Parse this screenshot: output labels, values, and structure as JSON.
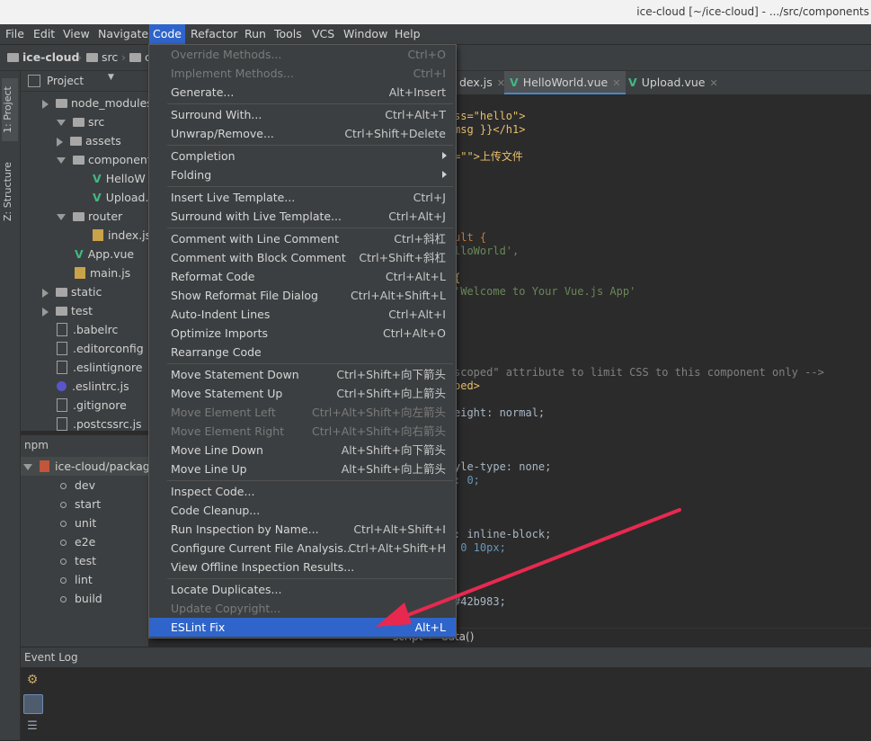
{
  "window": {
    "title": "ice-cloud [~/ice-cloud] - .../src/components"
  },
  "menubar": [
    "File",
    "Edit",
    "View",
    "Navigate",
    "Code",
    "Refactor",
    "Run",
    "Tools",
    "VCS",
    "Window",
    "Help"
  ],
  "active_menu": "Code",
  "breadcrumb": [
    "ice-cloud",
    "src",
    "c"
  ],
  "left_tools": {
    "project": "1: Project",
    "structure": "Z: Structure"
  },
  "project_panel": {
    "title": "Project",
    "tree": [
      {
        "label": "node_modules",
        "type": "folder",
        "state": "collapsed"
      },
      {
        "label": "src",
        "type": "folder",
        "state": "expanded"
      },
      {
        "label": "assets",
        "type": "folder",
        "state": "collapsed"
      },
      {
        "label": "component",
        "type": "folder",
        "state": "expanded"
      },
      {
        "label": "HelloW",
        "type": "vue"
      },
      {
        "label": "Upload.",
        "type": "vue"
      },
      {
        "label": "router",
        "type": "folder",
        "state": "expanded"
      },
      {
        "label": "index.js",
        "type": "js"
      },
      {
        "label": "App.vue",
        "type": "vue"
      },
      {
        "label": "main.js",
        "type": "js"
      },
      {
        "label": "static",
        "type": "folder",
        "state": "collapsed"
      },
      {
        "label": "test",
        "type": "folder",
        "state": "collapsed"
      },
      {
        "label": ".babelrc",
        "type": "doc"
      },
      {
        "label": ".editorconfig",
        "type": "doc"
      },
      {
        "label": ".eslintignore",
        "type": "doc"
      },
      {
        "label": ".eslintrc.js",
        "type": "circle"
      },
      {
        "label": ".gitignore",
        "type": "doc"
      },
      {
        "label": ".postcssrc.js",
        "type": "doc"
      }
    ]
  },
  "npm_panel": {
    "title": "npm",
    "root": "ice-cloud/package",
    "scripts": [
      "dev",
      "start",
      "unit",
      "e2e",
      "test",
      "lint",
      "build"
    ]
  },
  "editor": {
    "tabs": [
      {
        "label": "dex.js",
        "selected": false
      },
      {
        "label": "HelloWorld.vue",
        "selected": true
      },
      {
        "label": "Upload.vue",
        "selected": false
      }
    ],
    "code_lines": [
      {
        "text": "ss=\"hello\">"
      },
      {
        "text": "msg }}</h1>"
      },
      {
        "text": "=\"\">上传文件"
      },
      {
        "text": "ult {"
      },
      {
        "text": "lloWorld',"
      },
      {
        "text": "{"
      },
      {
        "text": "'Welcome to Your Vue.js App'"
      },
      {
        "text": "scoped\" attribute to limit CSS to this component only -->"
      },
      {
        "text": "ped>"
      },
      {
        "text": "eight: normal;"
      },
      {
        "text": "yle-type: none;"
      },
      {
        "text": ": 0;"
      },
      {
        "text": ": inline-block;"
      },
      {
        "text": " 0 10px;"
      },
      {
        "text": "#42b983;"
      }
    ],
    "status_path": [
      "script",
      "data()"
    ]
  },
  "event_log": {
    "title": "Event Log"
  },
  "code_menu": {
    "items": [
      {
        "label": "Override Methods...",
        "shortcut": "Ctrl+O",
        "disabled": true
      },
      {
        "label": "Implement Methods...",
        "shortcut": "Ctrl+I",
        "disabled": true
      },
      {
        "label": "Generate...",
        "shortcut": "Alt+Insert"
      },
      {
        "sep": true
      },
      {
        "label": "Surround With...",
        "shortcut": "Ctrl+Alt+T"
      },
      {
        "label": "Unwrap/Remove...",
        "shortcut": "Ctrl+Shift+Delete"
      },
      {
        "sep": true
      },
      {
        "label": "Completion",
        "submenu": true
      },
      {
        "label": "Folding",
        "submenu": true
      },
      {
        "sep": true
      },
      {
        "label": "Insert Live Template...",
        "shortcut": "Ctrl+J"
      },
      {
        "label": "Surround with Live Template...",
        "shortcut": "Ctrl+Alt+J"
      },
      {
        "sep": true
      },
      {
        "label": "Comment with Line Comment",
        "shortcut": "Ctrl+斜杠"
      },
      {
        "label": "Comment with Block Comment",
        "shortcut": "Ctrl+Shift+斜杠"
      },
      {
        "label": "Reformat Code",
        "shortcut": "Ctrl+Alt+L"
      },
      {
        "label": "Show Reformat File Dialog",
        "shortcut": "Ctrl+Alt+Shift+L"
      },
      {
        "label": "Auto-Indent Lines",
        "shortcut": "Ctrl+Alt+I"
      },
      {
        "label": "Optimize Imports",
        "shortcut": "Ctrl+Alt+O"
      },
      {
        "label": "Rearrange Code",
        "shortcut": ""
      },
      {
        "sep": true
      },
      {
        "label": "Move Statement Down",
        "shortcut": "Ctrl+Shift+向下箭头"
      },
      {
        "label": "Move Statement Up",
        "shortcut": "Ctrl+Shift+向上箭头"
      },
      {
        "label": "Move Element Left",
        "shortcut": "Ctrl+Alt+Shift+向左箭头",
        "disabled": true
      },
      {
        "label": "Move Element Right",
        "shortcut": "Ctrl+Alt+Shift+向右箭头",
        "disabled": true
      },
      {
        "label": "Move Line Down",
        "shortcut": "Alt+Shift+向下箭头"
      },
      {
        "label": "Move Line Up",
        "shortcut": "Alt+Shift+向上箭头"
      },
      {
        "sep": true
      },
      {
        "label": "Inspect Code...",
        "shortcut": ""
      },
      {
        "label": "Code Cleanup...",
        "shortcut": ""
      },
      {
        "label": "Run Inspection by Name...",
        "shortcut": "Ctrl+Alt+Shift+I"
      },
      {
        "label": "Configure Current File Analysis...",
        "shortcut": "Ctrl+Alt+Shift+H"
      },
      {
        "label": "View Offline Inspection Results...",
        "shortcut": ""
      },
      {
        "sep": true
      },
      {
        "label": "Locate Duplicates...",
        "shortcut": ""
      },
      {
        "label": "Update Copyright...",
        "shortcut": "",
        "disabled": true
      },
      {
        "label": "ESLint Fix",
        "shortcut": "Alt+L",
        "highlighted": true
      }
    ]
  },
  "colors": {
    "menu_highlight": "#2f65ca",
    "annotation_arrow": "#e8294f",
    "vue_icon": "#41b883"
  }
}
